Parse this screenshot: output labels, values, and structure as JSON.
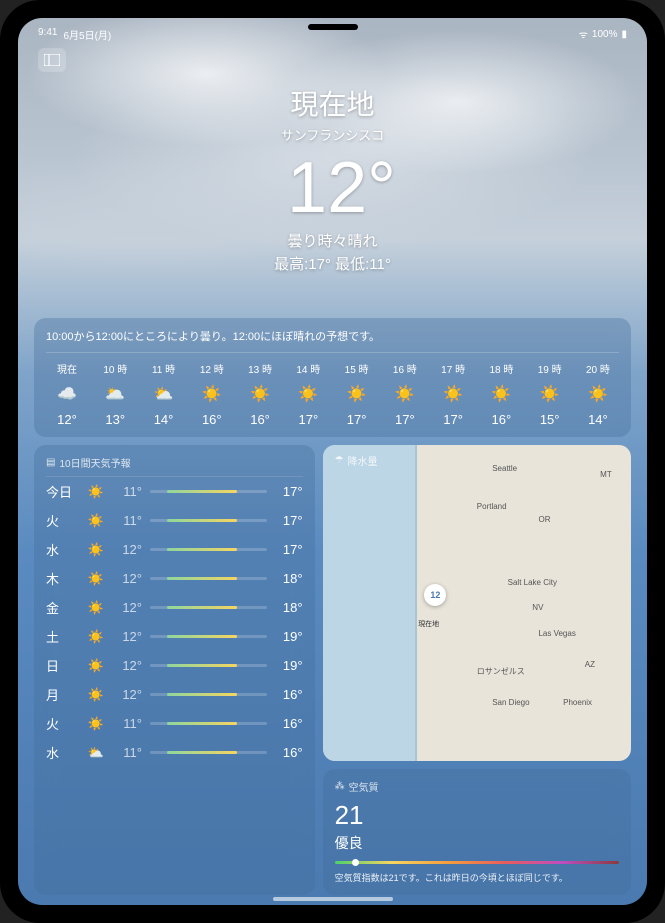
{
  "status": {
    "time": "9:41",
    "date": "6月5日(月)",
    "battery": "100%"
  },
  "header": {
    "location_title": "現在地",
    "location_sub": "サンフランシスコ",
    "temp": "12°",
    "condition": "曇り時々晴れ",
    "high_label": "最高:17°",
    "low_label": "最低:11°"
  },
  "hourly": {
    "summary": "10:00から12:00にところにより曇り。12:00にほぼ晴れの予想です。",
    "items": [
      {
        "time": "現在",
        "icon": "☁️",
        "temp": "12°"
      },
      {
        "time": "10 時",
        "icon": "🌥️",
        "temp": "13°"
      },
      {
        "time": "11 時",
        "icon": "⛅",
        "temp": "14°"
      },
      {
        "time": "12 時",
        "icon": "☀️",
        "temp": "16°"
      },
      {
        "time": "13 時",
        "icon": "☀️",
        "temp": "16°"
      },
      {
        "time": "14 時",
        "icon": "☀️",
        "temp": "17°"
      },
      {
        "time": "15 時",
        "icon": "☀️",
        "temp": "17°"
      },
      {
        "time": "16 時",
        "icon": "☀️",
        "temp": "17°"
      },
      {
        "time": "17 時",
        "icon": "☀️",
        "temp": "17°"
      },
      {
        "time": "18 時",
        "icon": "☀️",
        "temp": "16°"
      },
      {
        "time": "19 時",
        "icon": "☀️",
        "temp": "15°"
      },
      {
        "time": "20 時",
        "icon": "☀️",
        "temp": "14°"
      }
    ]
  },
  "daily": {
    "title": "10日間天気予報",
    "days": [
      {
        "day": "今日",
        "icon": "☀️",
        "lo": "11°",
        "hi": "17°"
      },
      {
        "day": "火",
        "icon": "☀️",
        "lo": "11°",
        "hi": "17°"
      },
      {
        "day": "水",
        "icon": "☀️",
        "lo": "12°",
        "hi": "17°"
      },
      {
        "day": "木",
        "icon": "☀️",
        "lo": "12°",
        "hi": "18°"
      },
      {
        "day": "金",
        "icon": "☀️",
        "lo": "12°",
        "hi": "18°"
      },
      {
        "day": "土",
        "icon": "☀️",
        "lo": "12°",
        "hi": "19°"
      },
      {
        "day": "日",
        "icon": "☀️",
        "lo": "12°",
        "hi": "19°"
      },
      {
        "day": "月",
        "icon": "☀️",
        "lo": "12°",
        "hi": "16°"
      },
      {
        "day": "火",
        "icon": "☀️",
        "lo": "11°",
        "hi": "16°"
      },
      {
        "day": "水",
        "icon": "⛅",
        "lo": "11°",
        "hi": "16°"
      }
    ]
  },
  "precip": {
    "title": "降水量",
    "pin_temp": "12",
    "pin_label": "現在地",
    "cities": {
      "seattle": "Seattle",
      "portland": "Portland",
      "slc": "Salt Lake City",
      "lv": "Las Vegas",
      "la": "ロサンゼルス",
      "sd": "San Diego",
      "phx": "Phoenix",
      "or": "OR",
      "nv": "NV",
      "az": "AZ",
      "mt": "MT"
    }
  },
  "aqi": {
    "title": "空気質",
    "value": "21",
    "grade": "優良",
    "desc": "空気質指数は21です。これは昨日の今頃とほぼ同じです。"
  }
}
